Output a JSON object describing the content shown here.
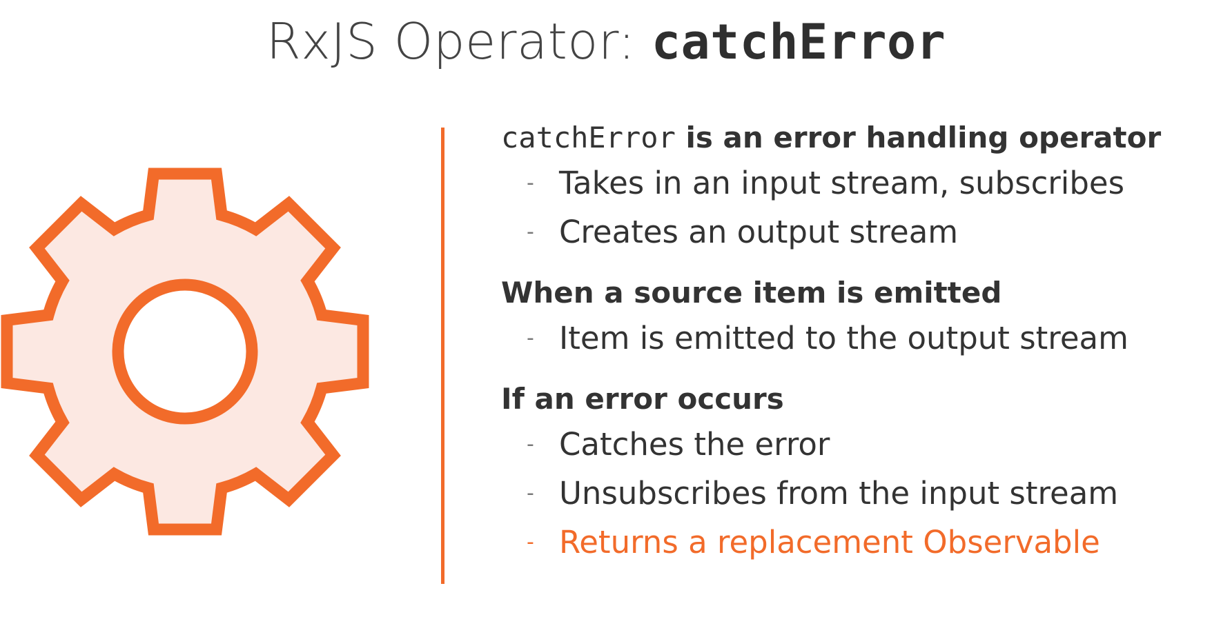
{
  "title": {
    "prefix": "RxJS Operator: ",
    "code": "catchError"
  },
  "colors": {
    "accent": "#f26b2a",
    "gear_fill": "#fce8e2",
    "text": "#333333"
  },
  "icon": "gear-icon",
  "sections": [
    {
      "heading_code": "catchError",
      "heading_text": " is an error handling operator",
      "items": [
        {
          "dash": "-",
          "text": "Takes in an input stream, subscribes"
        },
        {
          "dash": "-",
          "text": "Creates an output stream"
        }
      ]
    },
    {
      "heading_text": "When a source item is emitted",
      "items": [
        {
          "dash": "-",
          "text": "Item is emitted to the output stream"
        }
      ]
    },
    {
      "heading_text": "If an error occurs",
      "items": [
        {
          "dash": "-",
          "text": "Catches the error"
        },
        {
          "dash": "-",
          "text": "Unsubscribes from the input stream"
        },
        {
          "dash": "-",
          "text": "Returns a replacement Observable"
        }
      ]
    }
  ]
}
